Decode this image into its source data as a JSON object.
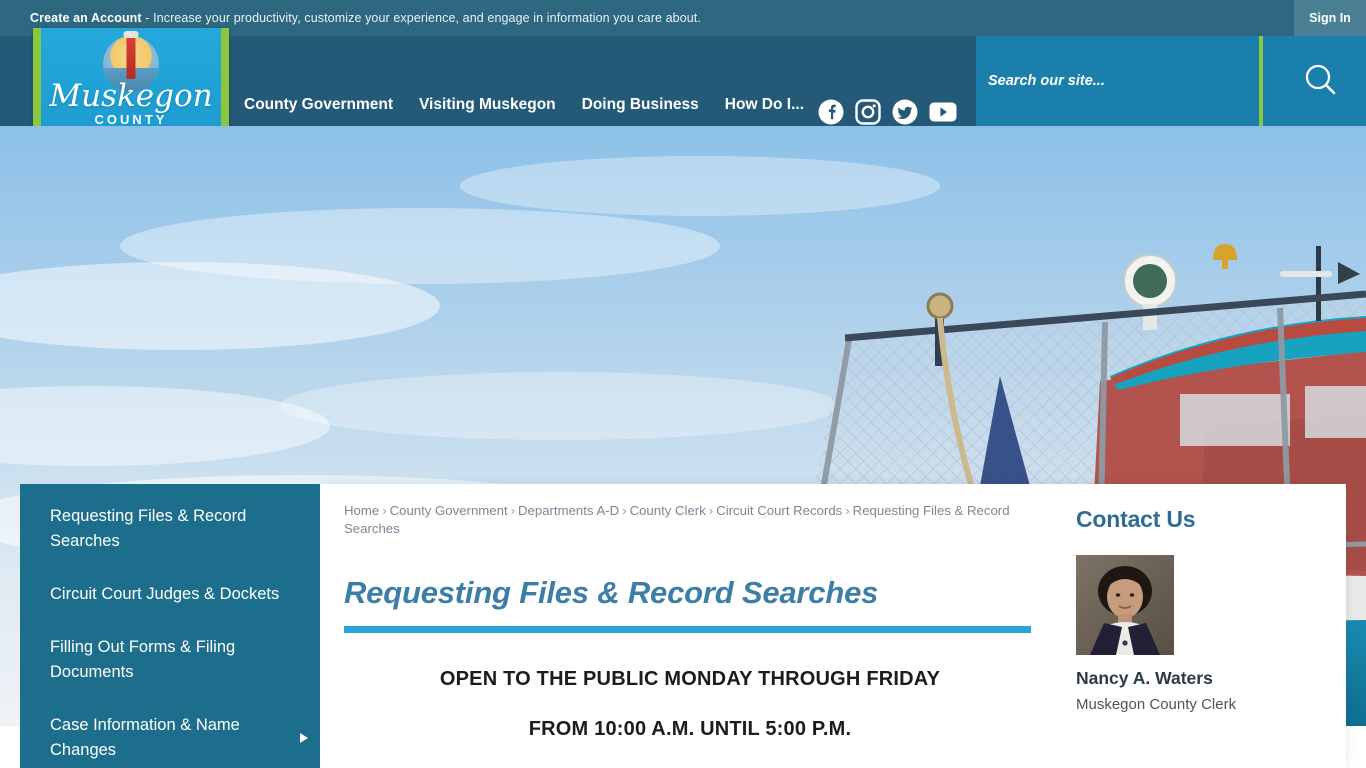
{
  "topbar": {
    "cta_bold": "Create an Account",
    "cta_rest": " - Increase your productivity, customize your experience, and engage in information you care about.",
    "signin_label": "Sign In"
  },
  "header": {
    "logo": {
      "script": "Muskegon",
      "county": "COUNTY"
    },
    "nav": [
      {
        "label": "County Government"
      },
      {
        "label": "Visiting Muskegon"
      },
      {
        "label": "Doing Business"
      },
      {
        "label": "How Do I..."
      }
    ],
    "social": [
      {
        "name": "facebook-icon"
      },
      {
        "name": "instagram-icon"
      },
      {
        "name": "twitter-icon"
      },
      {
        "name": "youtube-icon"
      }
    ],
    "search": {
      "placeholder": "Search our site...",
      "value": ""
    }
  },
  "sidebar": {
    "items": [
      {
        "label": "Requesting Files & Record Searches",
        "has_submenu": false
      },
      {
        "label": "Circuit Court Judges & Dockets",
        "has_submenu": false
      },
      {
        "label": "Filling Out Forms & Filing Documents",
        "has_submenu": false
      },
      {
        "label": "Case Information & Name Changes",
        "has_submenu": true
      }
    ]
  },
  "breadcrumb": {
    "items": [
      "Home",
      "County Government",
      "Departments A-D",
      "County Clerk",
      "Circuit Court Records",
      "Requesting Files & Record Searches"
    ],
    "separator": "›"
  },
  "main": {
    "title": "Requesting Files & Record Searches",
    "line1": "OPEN TO THE PUBLIC MONDAY THROUGH FRIDAY",
    "line2": "FROM 10:00 A.M. UNTIL 5:00 P.M."
  },
  "contact": {
    "heading": "Contact Us",
    "name": "Nancy A. Waters",
    "role": "Muskegon County Clerk"
  },
  "colors": {
    "topbar_bg": "#2e6880",
    "header_bg": "#245a77",
    "search_bg": "#1b7fab",
    "accent_green": "#8cc63e",
    "sidebar_bg": "#1d6e8c",
    "title_blue": "#3d7ea8",
    "rule_blue": "#2aa3db"
  }
}
